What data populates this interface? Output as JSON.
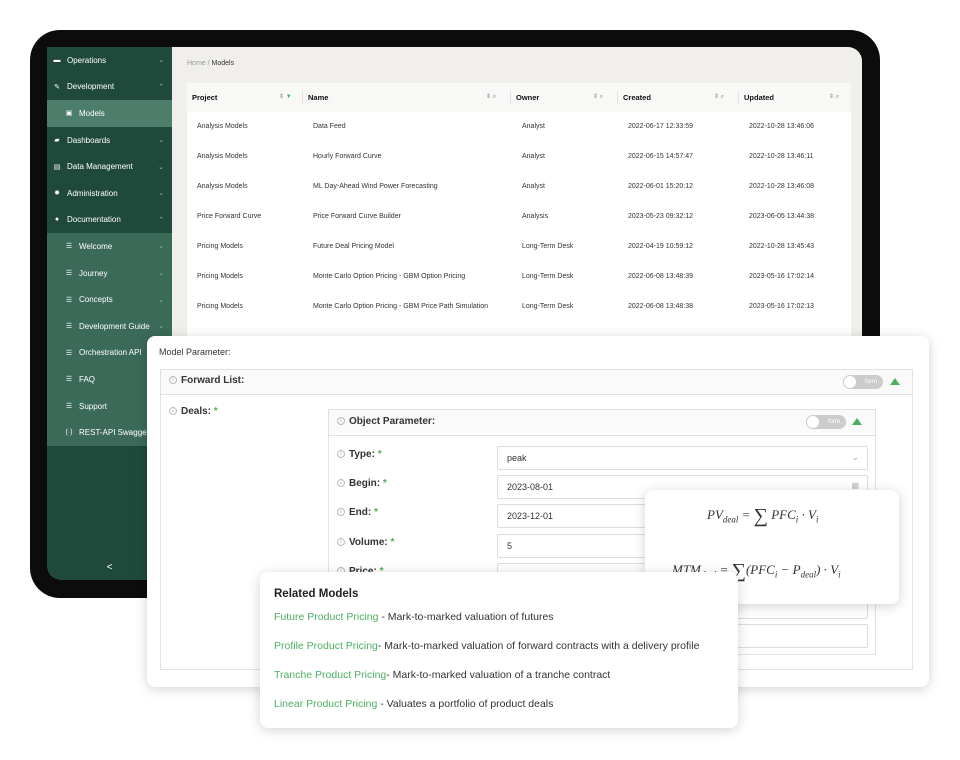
{
  "sidebar": {
    "items": [
      {
        "label": "Operations",
        "icon": "operations-icon",
        "chevron": "⌄"
      },
      {
        "label": "Development",
        "icon": "pencil-icon",
        "chevron": "⌃"
      },
      {
        "label": "Models",
        "icon": "model-icon",
        "sub": true,
        "selected": true
      },
      {
        "label": "Dashboards",
        "icon": "chart-icon",
        "chevron": "⌄"
      },
      {
        "label": "Data Management",
        "icon": "database-icon",
        "chevron": "⌄"
      },
      {
        "label": "Administration",
        "icon": "gear-icon",
        "chevron": "⌄"
      },
      {
        "label": "Documentation",
        "icon": "info-icon",
        "chevron": "⌃"
      },
      {
        "label": "Welcome",
        "icon": "list-icon",
        "sub": true,
        "chevron": "⌄"
      },
      {
        "label": "Journey",
        "icon": "list-icon",
        "sub": true,
        "chevron": "⌄"
      },
      {
        "label": "Concepts",
        "icon": "list-icon",
        "sub": true,
        "chevron": "⌄"
      },
      {
        "label": "Development Guide",
        "icon": "list-icon",
        "sub": true,
        "chevron": "⌄"
      },
      {
        "label": "Orchestration API",
        "icon": "list-icon",
        "sub": true
      },
      {
        "label": "FAQ",
        "icon": "list-icon",
        "sub": true
      },
      {
        "label": "Support",
        "icon": "list-icon",
        "sub": true
      },
      {
        "label": "REST-API Swagger",
        "icon": "api-icon",
        "sub": true
      }
    ],
    "collapse": "<"
  },
  "breadcrumb": {
    "home": "Home",
    "sep": "/",
    "current": "Models"
  },
  "table": {
    "columns": [
      "Project",
      "Name",
      "Owner",
      "Created",
      "Updated"
    ],
    "rows": [
      [
        "Analysis Models",
        "Data Feed",
        "Analyst",
        "2022-06-17 12:33:59",
        "2022-10-28 13:46:06"
      ],
      [
        "Analysis Models",
        "Hourly Forward Curve",
        "Analyst",
        "2022-06-15 14:57:47",
        "2022-10-28 13:46:11"
      ],
      [
        "Analysis Models",
        "ML Day-Ahead Wind Power Forecasting",
        "Analyst",
        "2022-06-01 15:20:12",
        "2022-10-28 13:46:08"
      ],
      [
        "Price Forward Curve",
        "Price Forward Curve Builder",
        "Analysis",
        "2023-05-23 09:32:12",
        "2023-06-05 13:44:38"
      ],
      [
        "Pricing Models",
        "Future Deal Pricing Model",
        "Long-Term Desk",
        "2022-04-19 10:59:12",
        "2022-10-28 13:45:43"
      ],
      [
        "Pricing Models",
        "Monte Carlo Option Pricing - GBM Option Pricing",
        "Long-Term Desk",
        "2022-06-08 13:48:39",
        "2023-05-16 17:02:14"
      ],
      [
        "Pricing Models",
        "Monte Carlo Option Pricing - GBM Price Path Simulation",
        "Long-Term Desk",
        "2022-06-08 13:48:38",
        "2023-05-16 17:02:13"
      ]
    ]
  },
  "form": {
    "title": "Model Parameter:",
    "forward_list": "Forward List:",
    "toggle": "form",
    "deals": "Deals:",
    "object_param": "Object Parameter:",
    "required": "*",
    "fields": [
      {
        "label": "Type:",
        "value": "peak"
      },
      {
        "label": "Begin:",
        "value": "2023-08-01"
      },
      {
        "label": "End:",
        "value": "2023-12-01"
      },
      {
        "label": "Volume:",
        "value": "5"
      },
      {
        "label": "Price:",
        "value": ""
      }
    ]
  },
  "formulas": {
    "pv": {
      "lhs": "PV",
      "lsub": "deal",
      "rhs": "PFC",
      "rsub": "i",
      "v": "V",
      "vsub": "i"
    },
    "mtm": {
      "lhs": "MTM",
      "lsub": "deal",
      "p": "P",
      "psub": "deal"
    }
  },
  "related": {
    "title": "Related Models",
    "items": [
      {
        "link": "Future Product Pricing",
        "desc": " - Mark-to-marked valuation of futures"
      },
      {
        "link": "Profile Product Pricing",
        "desc": "- Mark-to-marked valuation of forward contracts with a delivery profile"
      },
      {
        "link": "Tranche Product Pricing",
        "desc": "- Mark-to-marked valuation of a tranche contract"
      },
      {
        "link": "Linear Product Pricing",
        "desc": " - Valuates a portfolio of product deals"
      }
    ]
  },
  "colors": {
    "sidebar": "#1f4a3b",
    "accent": "#4caf62"
  }
}
